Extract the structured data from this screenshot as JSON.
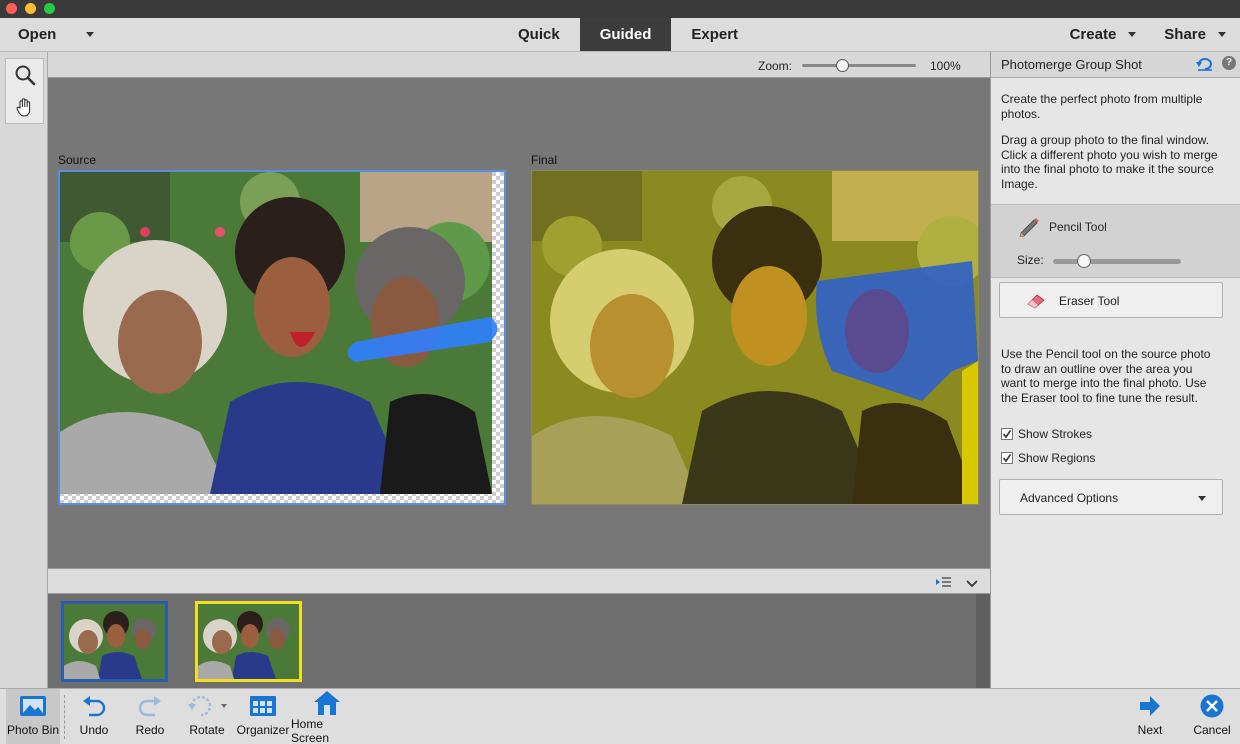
{
  "menubar": {
    "open_label": "Open",
    "modes": [
      "Quick",
      "Guided",
      "Expert"
    ],
    "active_mode": "Guided",
    "create_label": "Create",
    "share_label": "Share"
  },
  "tools": {
    "items": [
      "zoom-tool",
      "hand-tool"
    ]
  },
  "zoom": {
    "label": "Zoom:",
    "value": "100%",
    "level_percent": 100
  },
  "canvas": {
    "source_label": "Source",
    "final_label": "Final"
  },
  "photo_bin": {
    "thumb_count": 2,
    "thumb_colors": [
      "#2a5ca8",
      "#f0e020"
    ]
  },
  "right_panel": {
    "title": "Photomerge Group Shot",
    "intro": "Create the perfect photo from multiple photos.",
    "instructions": "Drag a group photo to the final window. Click a different photo you wish to merge into the final photo to make it the source Image.",
    "pencil_tool_label": "Pencil Tool",
    "size_label": "Size:",
    "eraser_tool_label": "Eraser Tool",
    "help_text": "Use the Pencil tool on the source photo to draw an outline over the area you want to merge into the final photo. Use the Eraser tool to fine tune the result.",
    "show_strokes_label": "Show Strokes",
    "show_strokes_checked": true,
    "show_regions_label": "Show Regions",
    "show_regions_checked": true,
    "advanced_options_label": "Advanced Options"
  },
  "bottom_bar": {
    "photo_bin": "Photo Bin",
    "undo": "Undo",
    "redo": "Redo",
    "rotate": "Rotate",
    "organizer": "Organizer",
    "home_screen": "Home Screen",
    "next": "Next",
    "cancel": "Cancel"
  },
  "colors": {
    "stroke_blue": "#2f7fff",
    "region_yellow": "#d8c800",
    "accent_blue": "#1a74d2"
  }
}
